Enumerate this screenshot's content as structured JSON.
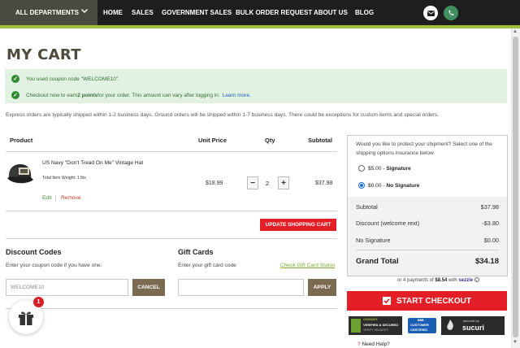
{
  "nav": {
    "departments": "ALL DEPARTMENTS",
    "links": [
      "HOME",
      "SALES",
      "GOVERNMENT SALES",
      "BULK ORDER REQUEST",
      "ABOUT US",
      "BLOG"
    ],
    "icons": [
      "envelope-icon",
      "phone-icon"
    ],
    "colors": {
      "bar": "#1e1e1e",
      "accent": "#9cc23a"
    }
  },
  "page": {
    "title": "MY CART"
  },
  "notices": {
    "coupon": "You used coupon code \"WELCOME10\".",
    "points_prefix": "Checkout now to earn ",
    "points_bold": "2 points",
    "points_suffix": " for your order. This amount can vary after logging in.",
    "learn_more": "Learn more."
  },
  "ship_note": "Express orders are typically shipped within 1-2 business days. Ground orders will be shipped within 1-7 business days. There could be exceptions for custom items and special orders.",
  "table": {
    "headers": [
      "Product",
      "Unit Price",
      "Qty",
      "Subtotal"
    ],
    "items": [
      {
        "name": "US Navy \"Don't Tread On Me\" Vintage Hat",
        "weight": "Total Item Weight: 1 lbs",
        "edit": "Edit",
        "remove": "Remove",
        "unit_price": "$18.99",
        "qty": "2",
        "subtotal": "$37.98"
      }
    ],
    "update_label": "UPDATE SHOPPING CART"
  },
  "discount": {
    "title": "Discount Codes",
    "subtitle": "Enter your coupon code if you have one.",
    "value": "WELCOME10",
    "button": "CANCEL"
  },
  "gift": {
    "title": "Gift Cards",
    "subtitle": "Enter your gift card code",
    "check_link": "Check Gift Card Status",
    "value": "",
    "button": "APPLY"
  },
  "gift_widget": {
    "badge": "1"
  },
  "summary": {
    "question": "Would you like to protect your shipment? Select one of the shipping options insurance below",
    "options": [
      {
        "price": "$5.00",
        "label": "Signature",
        "selected": false
      },
      {
        "price": "$0.00",
        "label": "No Signature",
        "selected": true
      }
    ],
    "lines": [
      {
        "label": "Subtotal",
        "value": "$37.98"
      },
      {
        "label": "Discount (welcome rext)",
        "value": "-$3.80"
      },
      {
        "label": "No Signature",
        "value": "$0.00"
      }
    ],
    "grand_label": "Grand Total",
    "grand_value": "$34.18",
    "installments_prefix": "or 4 payments of ",
    "installments_amount": "$8.54",
    "installments_with": " with ",
    "installments_brand": "sezzle",
    "checkout": "START CHECKOUT",
    "trust_badges": [
      {
        "line1": "GODADDY",
        "line2": "VERIFIED & SECURED",
        "line3": "VERIFY SECURITY"
      },
      {
        "line1": "BBB",
        "line2": "CUSTOMER",
        "line3": "CERTIFIED"
      },
      {
        "line1": "secured by",
        "line2": "sucuri"
      }
    ],
    "need_help": "Need Help?",
    "colors": {
      "primary": "#e41e26",
      "brown": "#7a6a52"
    }
  }
}
